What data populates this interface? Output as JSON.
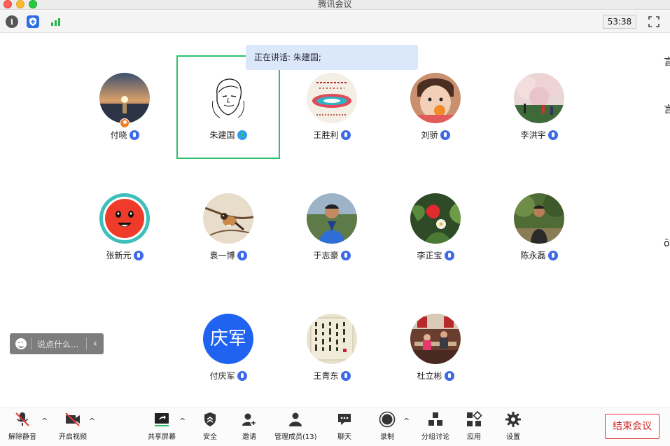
{
  "window": {
    "title": "腾讯会议"
  },
  "infobar": {
    "timer": "53:38"
  },
  "speaking": {
    "text": "正在讲话: 朱建国;"
  },
  "participants": [
    {
      "name": "付晓",
      "avatar": "sunset-photo",
      "host": true
    },
    {
      "name": "朱建国",
      "avatar": "sketch-portrait",
      "talking": true
    },
    {
      "name": "王胜利",
      "avatar": "calligraphy-seal"
    },
    {
      "name": "刘骄",
      "avatar": "child-photo"
    },
    {
      "name": "李洪宇",
      "avatar": "blossom-tree-photo"
    },
    {
      "name": "张新元",
      "avatar": "red-cartoon-face"
    },
    {
      "name": "袁一博",
      "avatar": "bird-photo"
    },
    {
      "name": "于志豪",
      "avatar": "man-outdoor-photo"
    },
    {
      "name": "李正宝",
      "avatar": "strawberry-plant-photo"
    },
    {
      "name": "陈永磊",
      "avatar": "man-garden-photo"
    },
    {
      "name": "付庆军",
      "avatar": "text-avatar",
      "avatar_text": "庆军",
      "color": "#1f63f0"
    },
    {
      "name": "王青东",
      "avatar": "calligraphy-scroll"
    },
    {
      "name": "杜立彬",
      "avatar": "indoor-photo"
    }
  ],
  "chat": {
    "placeholder": "说点什么..."
  },
  "toolbar": {
    "unmute": "解除静音",
    "video": "开启视频",
    "share": "共享屏幕",
    "security": "安全",
    "invite": "邀请",
    "members": "管理成员(13)",
    "chat": "聊天",
    "record": "录制",
    "breakout": "分组讨论",
    "apps": "应用",
    "settings": "设置",
    "end": "结束会议"
  },
  "colors": {
    "talking_border": "#2ec16b",
    "end_button": "#e23b3b",
    "mic_blue": "#3d6be8"
  }
}
